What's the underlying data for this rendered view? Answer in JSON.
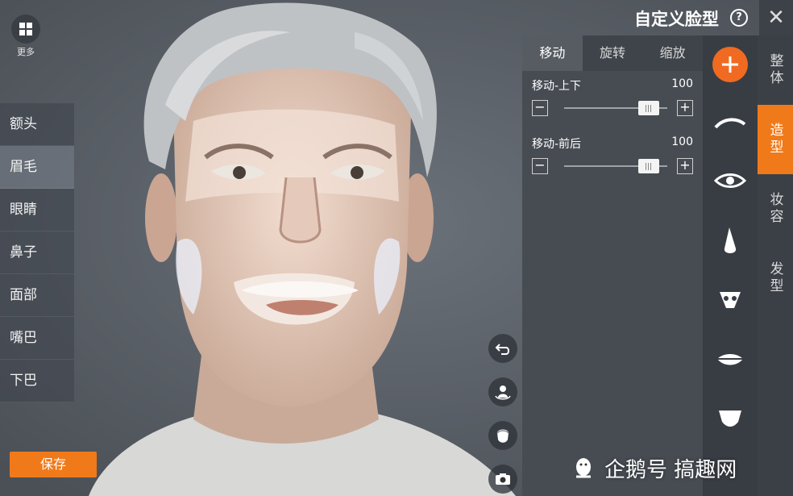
{
  "more": {
    "label": "更多"
  },
  "left_categories": [
    "额头",
    "眉毛",
    "眼睛",
    "鼻子",
    "面部",
    "嘴巴",
    "下巴"
  ],
  "left_active_index": 1,
  "save_label": "保存",
  "title": "自定义脸型",
  "help_glyph": "?",
  "close_glyph": "✕",
  "tabs": [
    "移动",
    "旋转",
    "缩放"
  ],
  "active_tab": 0,
  "sliders": [
    {
      "label": "移动-上下",
      "value": "100",
      "level": 0.82
    },
    {
      "label": "移动-前后",
      "value": "100",
      "level": 0.82
    }
  ],
  "minus_glyph": "−",
  "plus_glyph": "+",
  "feature_icons": [
    "forehead-icon",
    "eyebrow-icon",
    "eye-icon",
    "nose-icon",
    "nostril-icon",
    "lips-icon",
    "chin-icon"
  ],
  "right_categories": [
    "整体",
    "造型",
    "妆容",
    "发型"
  ],
  "right_active_index": 1,
  "watermark": "企鹅号 搞趣网",
  "colors": {
    "accent": "#f07a1a",
    "panel": "#474c53"
  }
}
